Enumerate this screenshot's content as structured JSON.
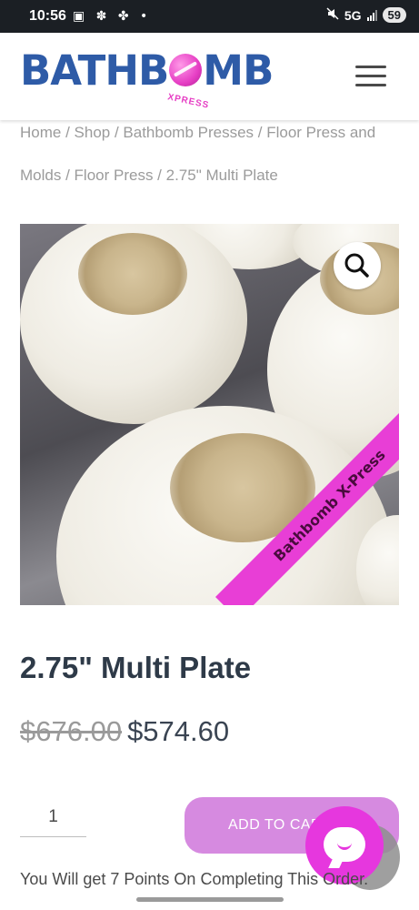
{
  "status_bar": {
    "time": "10:56",
    "left_icons": "▣ ✽ ✤ •",
    "network": "5G",
    "battery": "59"
  },
  "header": {
    "logo_text_left": "BATHB",
    "logo_text_right": "MB",
    "logo_sub": "XPRESS",
    "menu_icon": "hamburger-menu-icon"
  },
  "breadcrumb": {
    "items": [
      "Home",
      "Shop",
      "Bathbomb Presses",
      "Floor Press and Molds",
      "Floor Press"
    ],
    "current": "2.75\" Multi Plate",
    "separator": " / "
  },
  "product": {
    "image_watermark": "Bathbomb X-Press",
    "zoom_icon": "magnifier-icon",
    "title": "2.75\" Multi Plate",
    "price_old": "$676.00",
    "price_new": "$574.60",
    "quantity": "1",
    "add_to_cart_label": "ADD TO CAR",
    "points_text": "You Will get 7 Points On Completing This Order."
  },
  "colors": {
    "brand_blue": "#2e5ba7",
    "brand_pink": "#e63ec4",
    "button_pink": "#d68ae0",
    "chat_pink": "#e637de"
  }
}
